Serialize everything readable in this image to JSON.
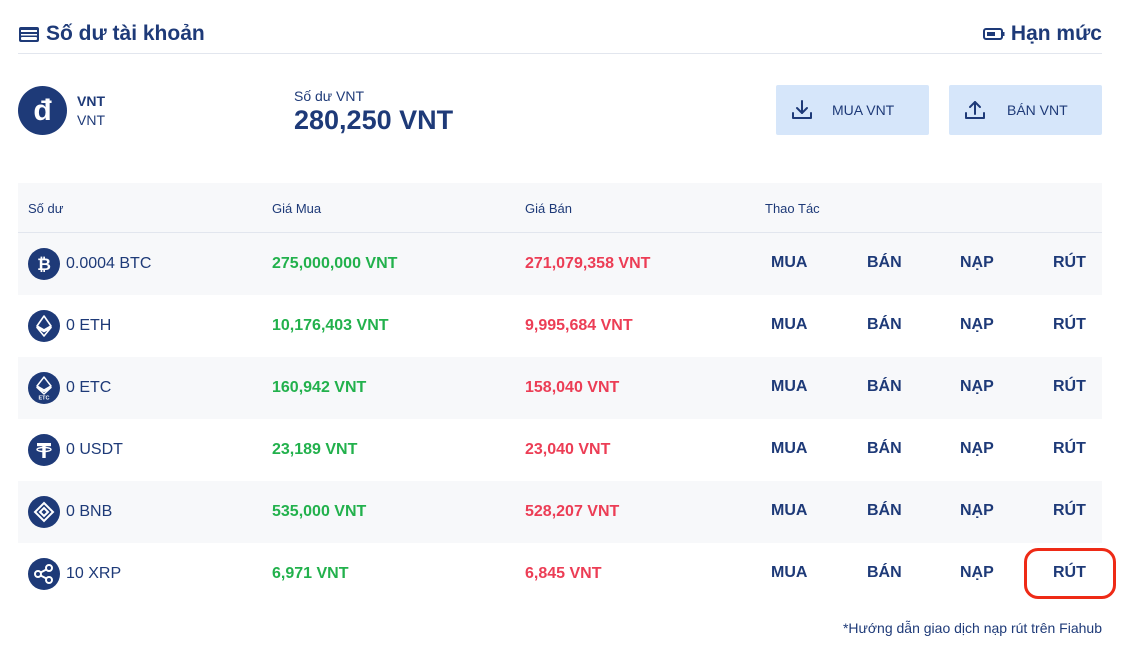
{
  "header": {
    "title": "Số dư tài khoản",
    "limit_label": "Hạn mức"
  },
  "account": {
    "coin_symbol": "đ",
    "name": "VNT",
    "sub": "VNT",
    "balance_label": "Số dư VNT",
    "balance_value": "280,250 VNT",
    "buy_button": "MUA VNT",
    "sell_button": "BÁN VNT"
  },
  "table": {
    "headers": [
      "Số dư",
      "Giá Mua",
      "Giá Bán",
      "Thao Tác"
    ],
    "actions": [
      "MUA",
      "BÁN",
      "NẠP",
      "RÚT"
    ],
    "rows": [
      {
        "coin": "btc",
        "balance": "0.0004 BTC",
        "buy": "275,000,000 VNT",
        "sell": "271,079,358 VNT"
      },
      {
        "coin": "eth",
        "balance": "0 ETH",
        "buy": "10,176,403 VNT",
        "sell": "9,995,684 VNT"
      },
      {
        "coin": "etc",
        "balance": "0 ETC",
        "buy": "160,942 VNT",
        "sell": "158,040 VNT"
      },
      {
        "coin": "usdt",
        "balance": "0 USDT",
        "buy": "23,189 VNT",
        "sell": "23,040 VNT"
      },
      {
        "coin": "bnb",
        "balance": "0 BNB",
        "buy": "535,000 VNT",
        "sell": "528,207 VNT"
      },
      {
        "coin": "xrp",
        "balance": "10 XRP",
        "buy": "6,971 VNT",
        "sell": "6,845 VNT"
      }
    ]
  },
  "footnote": "*Hướng dẫn giao dịch nạp rút trên Fiahub",
  "colors": {
    "navy": "#1e3a78",
    "green": "#22b14c",
    "red": "#ec3d55",
    "button_bg": "#d6e6fa",
    "highlight": "#ee2a16"
  }
}
